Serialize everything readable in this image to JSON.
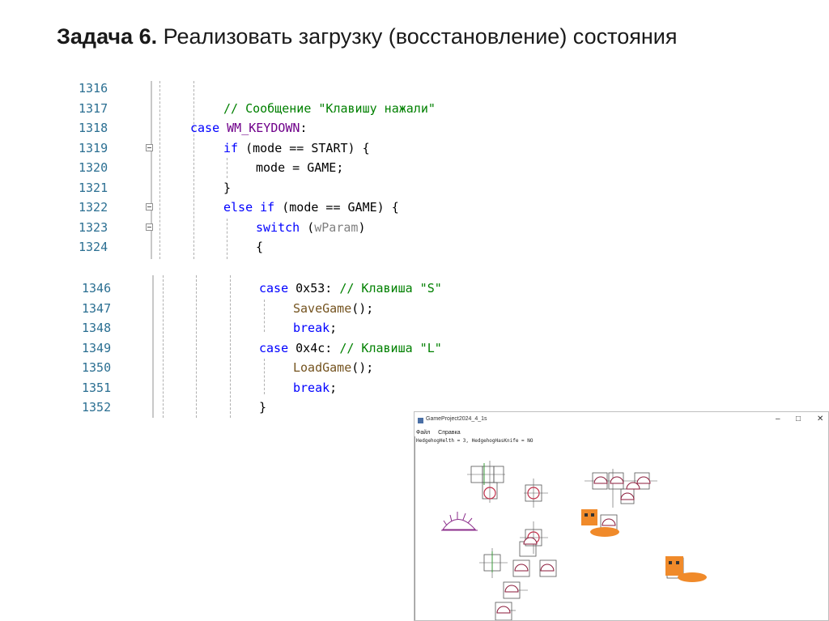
{
  "slide": {
    "title_bold": "Задача 6.",
    "title_rest": " Реализовать загрузку (восстановление) состояния"
  },
  "code_block_1": {
    "lines": [
      {
        "num": "1316",
        "parts": []
      },
      {
        "num": "1317",
        "parts": [
          {
            "t": "// Сообщение \"Клавишу нажали\"",
            "c": "cm"
          }
        ]
      },
      {
        "num": "1318",
        "parts": [
          {
            "t": "case",
            "c": "kw"
          },
          {
            "t": " "
          },
          {
            "t": "WM_KEYDOWN",
            "c": "mc"
          },
          {
            "t": ":"
          }
        ]
      },
      {
        "num": "1319",
        "parts": [
          {
            "t": "if",
            "c": "kw"
          },
          {
            "t": " (mode == START) {"
          }
        ]
      },
      {
        "num": "1320",
        "parts": [
          {
            "t": "mode = GAME;"
          }
        ]
      },
      {
        "num": "1321",
        "parts": [
          {
            "t": "}"
          }
        ]
      },
      {
        "num": "1322",
        "parts": [
          {
            "t": "else",
            "c": "kw"
          },
          {
            "t": " "
          },
          {
            "t": "if",
            "c": "kw"
          },
          {
            "t": " (mode == GAME) {"
          }
        ]
      },
      {
        "num": "1323",
        "parts": [
          {
            "t": "switch",
            "c": "kw"
          },
          {
            "t": " ("
          },
          {
            "t": "wParam",
            "c": "pm"
          },
          {
            "t": ")"
          }
        ]
      },
      {
        "num": "1324",
        "parts": [
          {
            "t": "{"
          }
        ]
      }
    ]
  },
  "code_block_2": {
    "lines": [
      {
        "num": "1346",
        "parts": [
          {
            "t": "case",
            "c": "kw"
          },
          {
            "t": " 0x53: "
          },
          {
            "t": "// Клавиша \"S\"",
            "c": "cm"
          }
        ]
      },
      {
        "num": "1347",
        "parts": [
          {
            "t": "SaveGame",
            "c": "fn"
          },
          {
            "t": "();"
          }
        ]
      },
      {
        "num": "1348",
        "parts": [
          {
            "t": "break",
            "c": "kw"
          },
          {
            "t": ";"
          }
        ]
      },
      {
        "num": "1349",
        "parts": [
          {
            "t": "case",
            "c": "kw"
          },
          {
            "t": " 0x4c: "
          },
          {
            "t": "// Клавиша \"L\"",
            "c": "cm"
          }
        ]
      },
      {
        "num": "1350",
        "parts": [
          {
            "t": "LoadGame",
            "c": "fn"
          },
          {
            "t": "();"
          }
        ]
      },
      {
        "num": "1351",
        "parts": [
          {
            "t": "break",
            "c": "kw"
          },
          {
            "t": ";"
          }
        ]
      },
      {
        "num": "1352",
        "parts": [
          {
            "t": "}"
          }
        ]
      }
    ]
  },
  "game_window": {
    "title": "GameProject2024_4_1s",
    "menu": [
      "Файл",
      "Справка"
    ],
    "status": "HedgehogHelth = 3, HedgehogHasKnife = NO",
    "colors": {
      "hedgehog": "#8b2d8b",
      "cat": "#f08a2a",
      "mushroom": "#8b1a3a"
    }
  }
}
